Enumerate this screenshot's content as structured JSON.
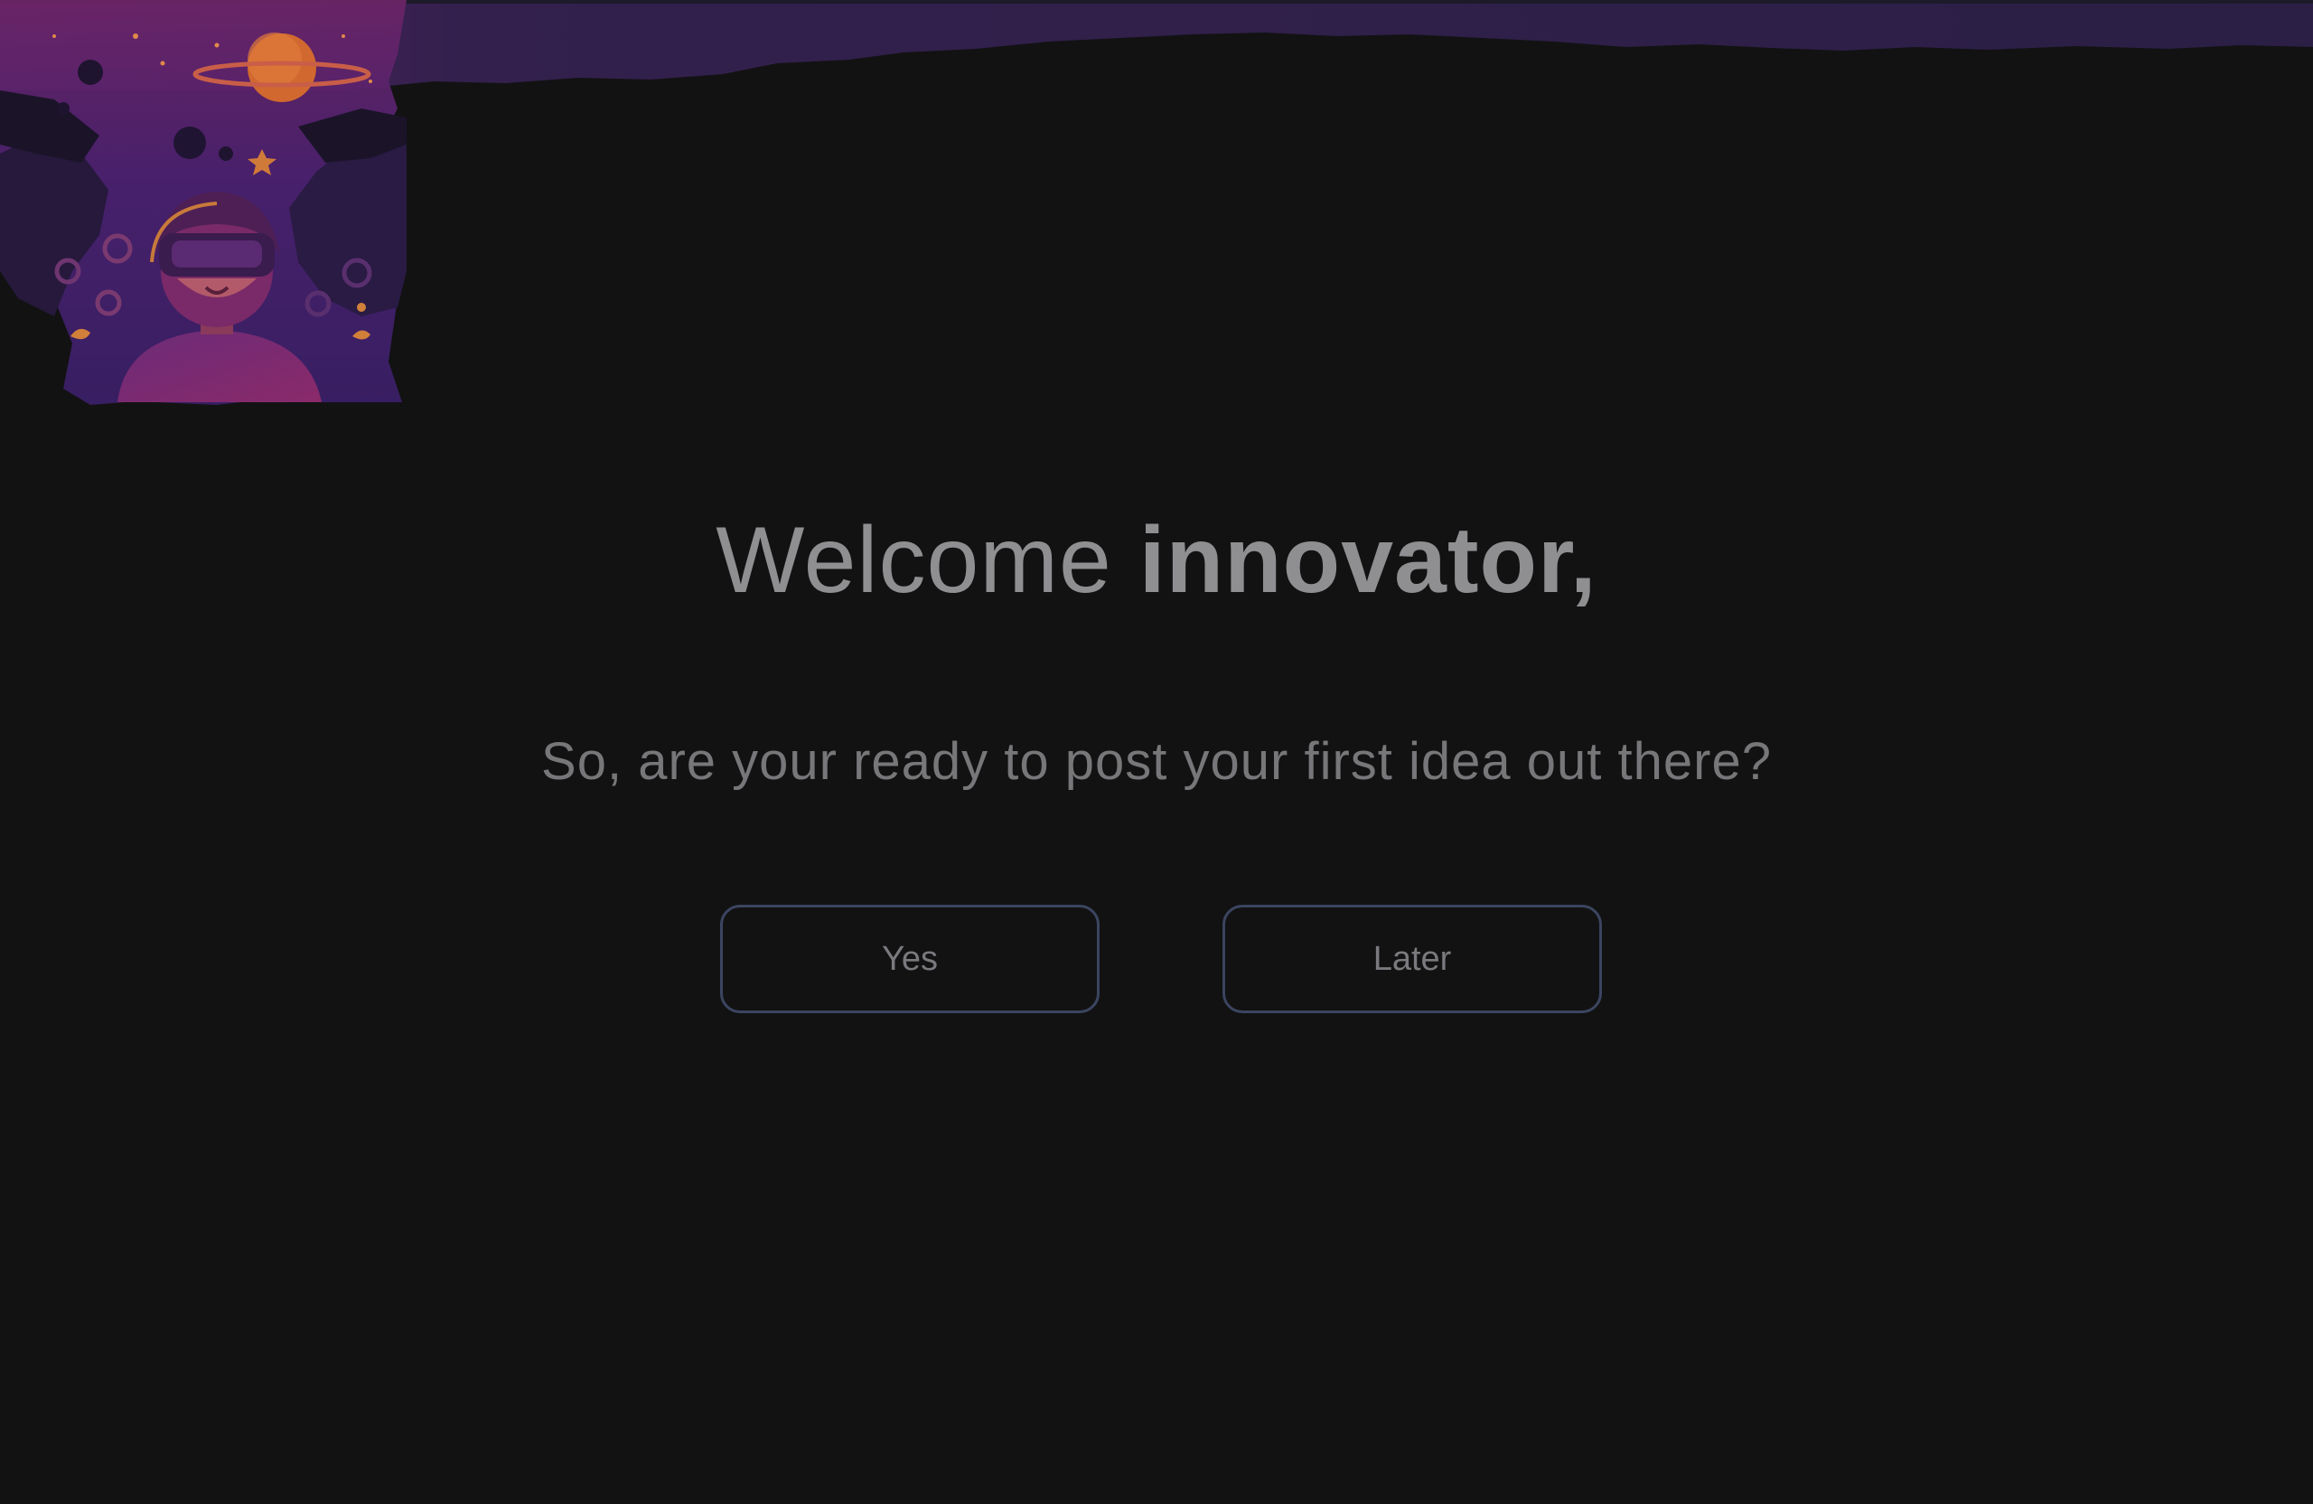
{
  "welcome": {
    "prefix": "Welcome ",
    "name": "innovator,"
  },
  "subtitle": "So, are your ready to post your first idea out there?",
  "actions": {
    "yes_label": "Yes",
    "later_label": "Later"
  },
  "colors": {
    "background": "#121213",
    "banner_purple": "#2a1d47",
    "accent_magenta": "#7a2a7c",
    "accent_orange": "#c96a3a",
    "button_border": "#3b4560"
  }
}
